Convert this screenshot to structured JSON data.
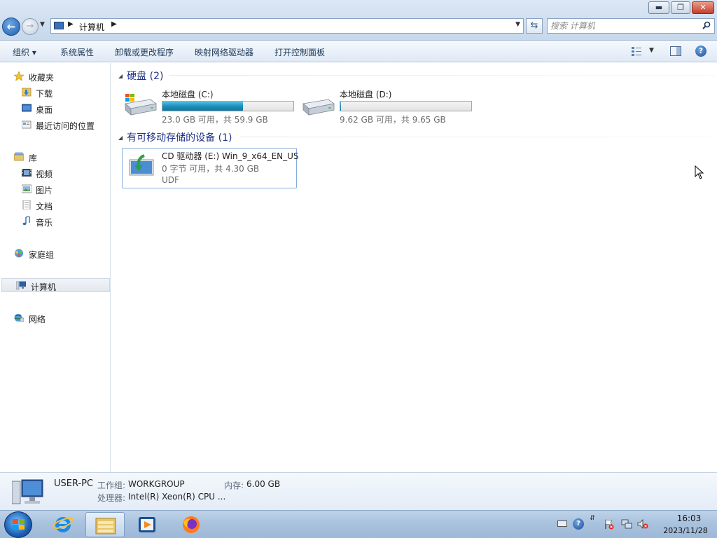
{
  "window": {
    "min_glyph": "▬",
    "max_glyph": "❐",
    "close_glyph": "✕"
  },
  "navigation": {
    "back_glyph": "←",
    "address_path": "计算机",
    "search_placeholder": "搜索 计算机"
  },
  "command_bar": {
    "organize": "组织 ▾",
    "system_properties": "系统属性",
    "uninstall_program": "卸载或更改程序",
    "map_network_drive": "映射网络驱动器",
    "open_control_panel": "打开控制面板",
    "help_glyph": "?"
  },
  "nav_pane": {
    "favorites": "收藏夹",
    "downloads": "下载",
    "desktop": "桌面",
    "recent_places": "最近访问的位置",
    "libraries": "库",
    "videos": "视频",
    "pictures": "图片",
    "documents": "文档",
    "music": "音乐",
    "homegroup": "家庭组",
    "computer": "计算机",
    "network": "网络"
  },
  "hard_disks": {
    "header": "硬盘 (2)",
    "items": [
      {
        "name": "本地磁盘 (C:)",
        "info": "23.0 GB 可用，共 59.9 GB",
        "used_fraction": 0.616
      },
      {
        "name": "本地磁盘 (D:)",
        "info": "9.62 GB 可用，共 9.65 GB",
        "used_fraction": 0.003
      }
    ]
  },
  "removable": {
    "header": "有可移动存储的设备 (1)",
    "cd": {
      "name": "CD 驱动器 (E:) Win_9_x64_EN_US",
      "info": "0 字节 可用，共 4.30 GB",
      "filesystem": "UDF"
    }
  },
  "details": {
    "computer_name": "USER-PC",
    "workgroup_label": "工作组:",
    "workgroup_value": "WORKGROUP",
    "memory_label": "内存:",
    "memory_value": "6.00 GB",
    "cpu_label": "处理器:",
    "cpu_value": "Intel(R) Xeon(R) CPU ..."
  },
  "taskbar": {
    "help_glyph": "?",
    "time": "16:03",
    "date": "2023/11/28"
  },
  "colors": {
    "accent": "#1e3287",
    "drive_bar": "#1e8fbd",
    "taskbar": "#a9c2de"
  }
}
